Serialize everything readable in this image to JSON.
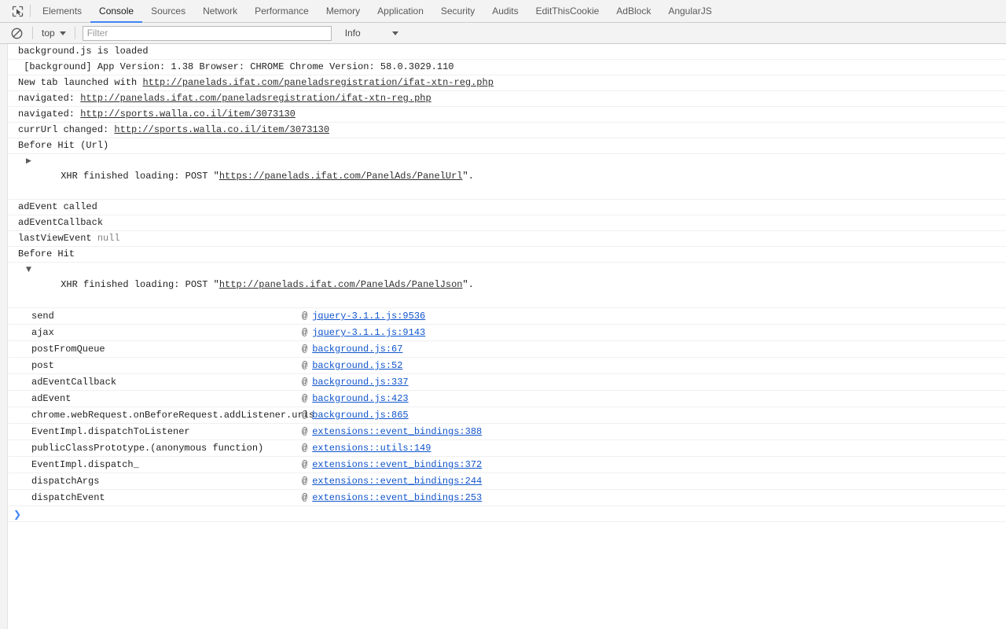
{
  "devtools": {
    "inspect_icon": "inspect-element-icon",
    "tabs": [
      {
        "label": "Elements",
        "active": false
      },
      {
        "label": "Console",
        "active": true
      },
      {
        "label": "Sources",
        "active": false
      },
      {
        "label": "Network",
        "active": false
      },
      {
        "label": "Performance",
        "active": false
      },
      {
        "label": "Memory",
        "active": false
      },
      {
        "label": "Application",
        "active": false
      },
      {
        "label": "Security",
        "active": false
      },
      {
        "label": "Audits",
        "active": false
      },
      {
        "label": "EditThisCookie",
        "active": false
      },
      {
        "label": "AdBlock",
        "active": false
      },
      {
        "label": "AngularJS",
        "active": false
      }
    ],
    "accent_color": "#4285f4"
  },
  "toolbar": {
    "clear_icon": "clear-console-icon",
    "context": "top",
    "filter_value": "",
    "filter_placeholder": "Filter",
    "level": "Info"
  },
  "console": {
    "messages": [
      {
        "text": "background.js is loaded"
      },
      {
        "text": " [background] App Version: 1.38 Browser: CHROME Chrome Version: 58.0.3029.110"
      },
      {
        "prefix": "New tab launched with ",
        "link": "http://panelads.ifat.com/paneladsregistration/ifat-xtn-reg.php"
      },
      {
        "prefix": "navigated: ",
        "link": "http://panelads.ifat.com/paneladsregistration/ifat-xtn-reg.php"
      },
      {
        "prefix": "navigated: ",
        "link": "http://sports.walla.co.il/item/3073130"
      },
      {
        "prefix": "currUrl changed: ",
        "link": "http://sports.walla.co.il/item/3073130"
      },
      {
        "text": "Before Hit (Url)"
      },
      {
        "disclosure": "collapsed",
        "prefix": "XHR finished loading: POST \"",
        "link": "https://panelads.ifat.com/PanelAds/PanelUrl",
        "suffix": "\"."
      },
      {
        "text": "adEvent called"
      },
      {
        "text": "adEventCallback"
      },
      {
        "prefix": "lastViewEvent ",
        "null_value": "null"
      },
      {
        "text": "Before Hit"
      },
      {
        "disclosure": "expanded",
        "prefix": "XHR finished loading: POST \"",
        "link": "http://panelads.ifat.com/PanelAds/PanelJson",
        "suffix": "\"."
      }
    ],
    "stack_trace": [
      {
        "fn": "send",
        "at": "@",
        "loc": "jquery-3.1.1.js:9536"
      },
      {
        "fn": "ajax",
        "at": "@",
        "loc": "jquery-3.1.1.js:9143"
      },
      {
        "fn": "postFromQueue",
        "at": "@",
        "loc": "background.js:67"
      },
      {
        "fn": "post",
        "at": "@",
        "loc": "background.js:52"
      },
      {
        "fn": "adEventCallback",
        "at": "@",
        "loc": "background.js:337"
      },
      {
        "fn": "adEvent",
        "at": "@",
        "loc": "background.js:423"
      },
      {
        "fn": "chrome.webRequest.onBeforeRequest.addListener.urls",
        "at": "@",
        "loc": "background.js:865"
      },
      {
        "fn": "EventImpl.dispatchToListener",
        "at": "@",
        "loc": "extensions::event_bindings:388"
      },
      {
        "fn": "publicClassPrototype.(anonymous function)",
        "at": "@",
        "loc": "extensions::utils:149"
      },
      {
        "fn": "EventImpl.dispatch_",
        "at": "@",
        "loc": "extensions::event_bindings:372"
      },
      {
        "fn": "dispatchArgs",
        "at": "@",
        "loc": "extensions::event_bindings:244"
      },
      {
        "fn": "dispatchEvent",
        "at": "@",
        "loc": "extensions::event_bindings:253"
      }
    ],
    "prompt_symbol": "❯",
    "prompt_value": ""
  }
}
